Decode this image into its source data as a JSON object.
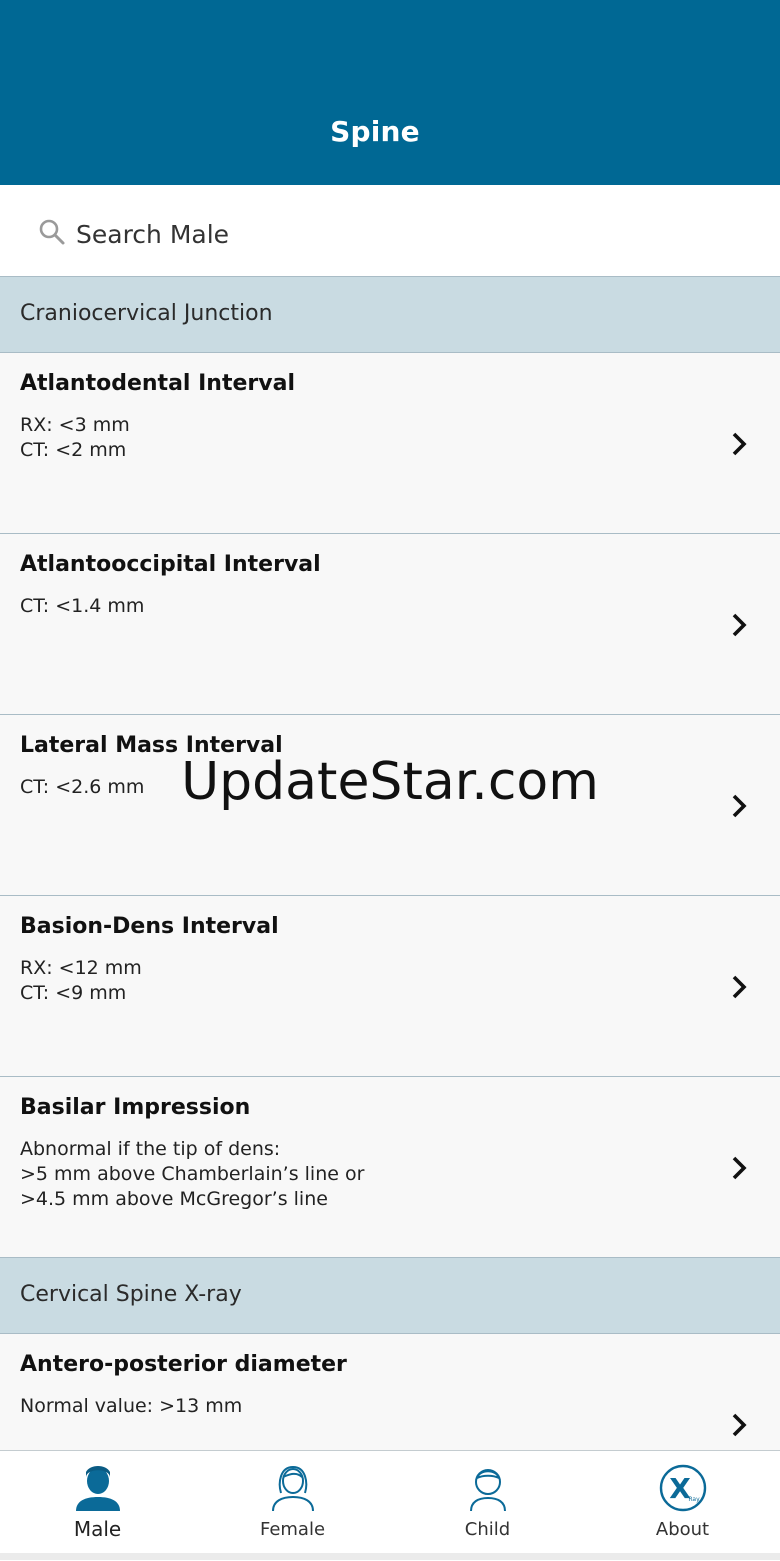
{
  "header": {
    "title": "Spine"
  },
  "search": {
    "placeholder": "Search Male"
  },
  "sections": [
    {
      "title": "Craniocervical Junction",
      "items": [
        {
          "title": "Atlantodental Interval",
          "lines": [
            "RX: <3 mm",
            "CT: <2 mm"
          ]
        },
        {
          "title": "Atlantooccipital Interval",
          "lines": [
            "CT: <1.4 mm"
          ]
        },
        {
          "title": "Lateral Mass Interval",
          "lines": [
            "CT: <2.6 mm"
          ]
        },
        {
          "title": "Basion-Dens Interval",
          "lines": [
            "RX: <12 mm",
            "CT: <9 mm"
          ]
        },
        {
          "title": "Basilar Impression",
          "lines": [
            "Abnormal if the tip of dens:",
            ">5 mm above Chamberlain’s line or",
            ">4.5 mm above McGregor’s line"
          ]
        }
      ]
    },
    {
      "title": "Cervical Spine X-ray",
      "items": [
        {
          "title": "Antero-posterior diameter",
          "lines": [
            "Normal value: >13 mm"
          ]
        }
      ]
    }
  ],
  "watermark": "UpdateStar.com",
  "tabs": [
    {
      "label": "Male",
      "icon": "male-avatar-icon",
      "active": true
    },
    {
      "label": "Female",
      "icon": "female-avatar-icon",
      "active": false
    },
    {
      "label": "Child",
      "icon": "child-avatar-icon",
      "active": false
    },
    {
      "label": "About",
      "icon": "xray-logo-icon",
      "active": false
    }
  ],
  "about_logo_text": "X",
  "about_logo_sub": "Ray",
  "colors": {
    "header": "#006894",
    "section": "#c9dbe2",
    "icon_blue": "#0b6a98"
  }
}
